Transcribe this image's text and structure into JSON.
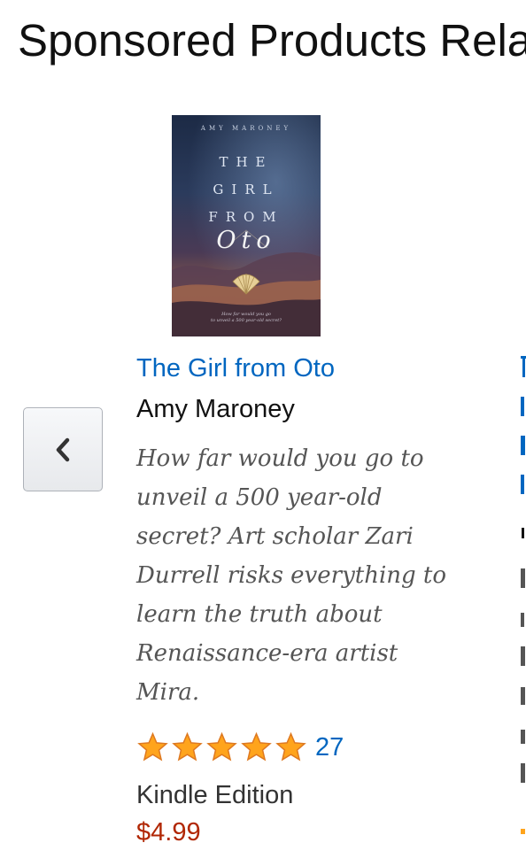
{
  "section": {
    "title": "Sponsored Products Rela"
  },
  "carousel": {
    "prev_icon": "chevron-left-icon"
  },
  "product": {
    "cover": {
      "author": "AMY MARONEY",
      "title": "THE\nGIRL\nFROM",
      "title_script": "Oto",
      "tagline": "How far would you go\nto unveil a 500 year-old secret?"
    },
    "title": "The Girl from Oto",
    "author": "Amy Maroney",
    "blurb": "How far would you go to unveil a 500 year-old secret? Art scholar Zari Durrell risks everything to learn the truth about Renaissance-era artist Mira.",
    "rating": {
      "stars": 5,
      "icon": "star-icon",
      "color": "#ffa41c",
      "count": "27"
    },
    "format": "Kindle Edition",
    "price": "$4.99"
  },
  "colors": {
    "link": "#0066c0",
    "price": "#b12704",
    "text": "#111111"
  }
}
